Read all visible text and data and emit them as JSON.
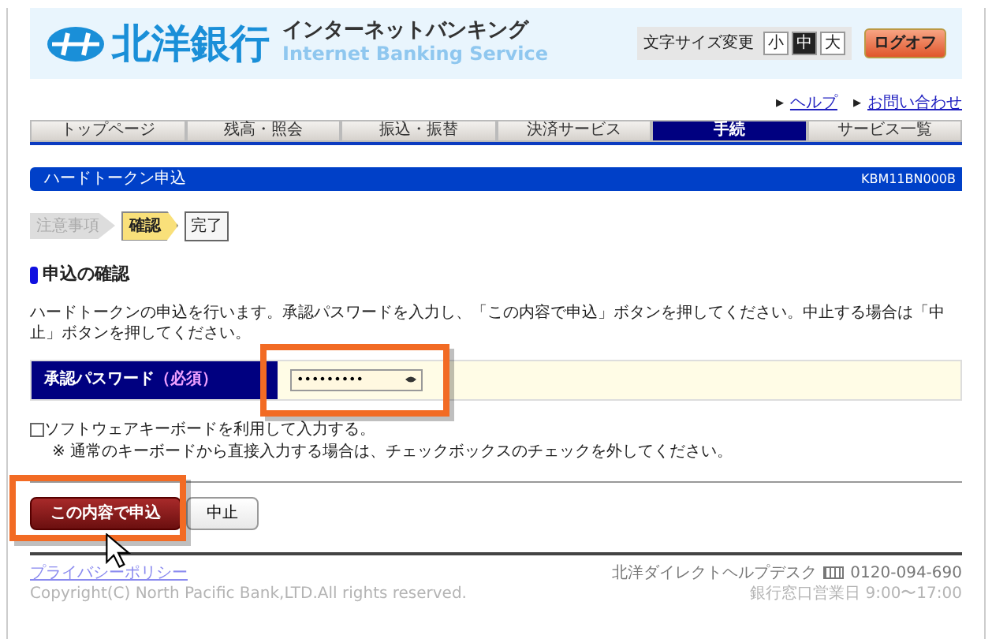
{
  "header": {
    "bank_name": "北洋銀行",
    "service_name": "インターネットバンキング",
    "service_name_en": "Internet Banking Service",
    "font_size_label": "文字サイズ変更",
    "font_sizes": [
      {
        "label": "小",
        "selected": false
      },
      {
        "label": "中",
        "selected": true
      },
      {
        "label": "大",
        "selected": false
      }
    ],
    "logoff": "ログオフ"
  },
  "links": [
    {
      "arrow": "▸",
      "label": "ヘルプ"
    },
    {
      "arrow": "▸",
      "label": "お問い合わせ"
    }
  ],
  "tabs": [
    {
      "label": "トップページ",
      "selected": false
    },
    {
      "label": "残高・照会",
      "selected": false
    },
    {
      "label": "振込・振替",
      "selected": false
    },
    {
      "label": "決済サービス",
      "selected": false
    },
    {
      "label": "手続",
      "selected": true
    },
    {
      "label": "サービス一覧",
      "selected": false
    }
  ],
  "page_title": {
    "title": "ハードトークン申込",
    "code": "KBM11BN000B"
  },
  "steps": [
    {
      "label": "注意事項",
      "kind": "past"
    },
    {
      "label": "確認",
      "kind": "current"
    },
    {
      "label": "完了",
      "kind": "next"
    }
  ],
  "section_heading": "申込の確認",
  "description": "ハードトークンの申込を行います。承認パスワードを入力し、「この内容で申込」ボタンを押してください。中止する場合は「中止」ボタンを押してください。",
  "form": {
    "label": "承認パスワード",
    "required": "（必須）",
    "value": "•••••••••"
  },
  "software_keyboard": {
    "label": "ソフトウェアキーボードを利用して入力する。",
    "checked": false,
    "note": "※ 通常のキーボードから直接入力する場合は、チェックボックスのチェックを外してください。"
  },
  "buttons": [
    {
      "label": "この内容で申込",
      "kind": "primary"
    },
    {
      "label": "中止",
      "kind": "secondary"
    }
  ],
  "footer": {
    "privacy": "プライバシーポリシー",
    "helpdesk": "北洋ダイレクトヘルプデスク",
    "phone": "0120-094-690",
    "copyright": "Copyright(C) North Pacific Bank,LTD.All rights reserved.",
    "hours": "銀行窓口営業日 9:00〜17:00"
  }
}
